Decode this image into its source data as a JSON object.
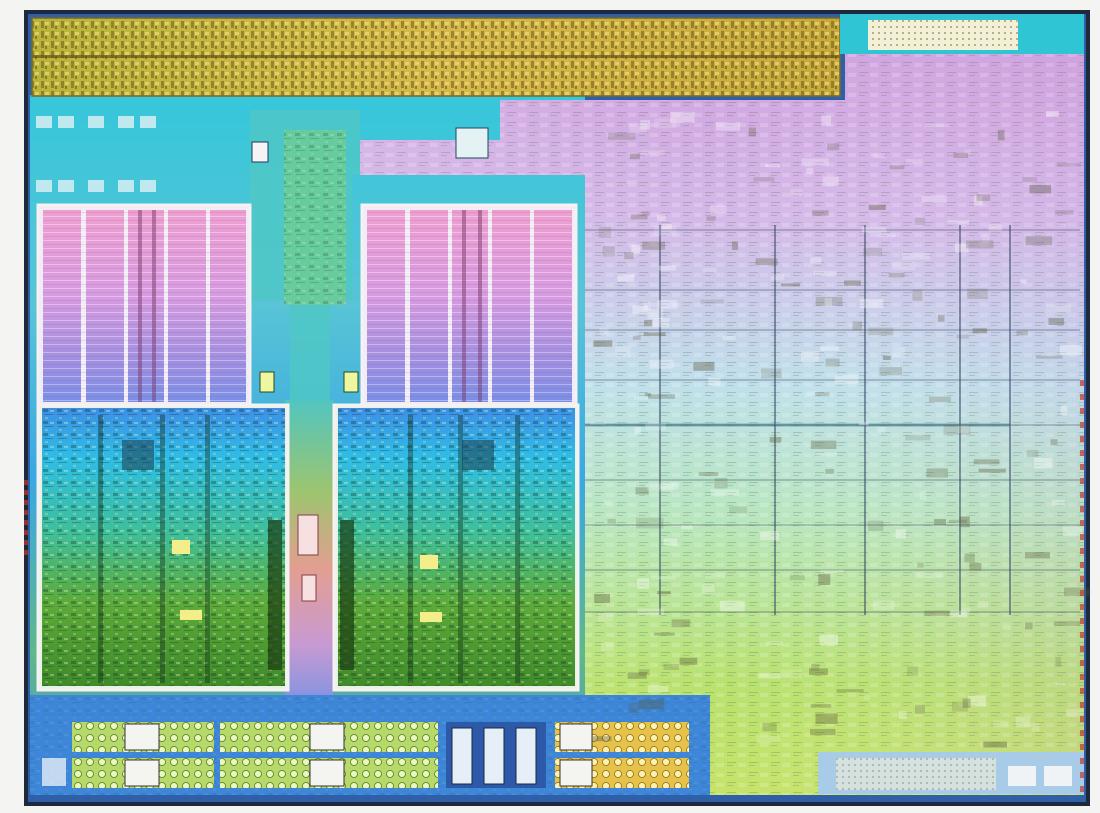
{
  "image": {
    "subject": "processor-die-photograph",
    "background_color": "#f4f4f2",
    "die_border_color": "#1e2a3c"
  },
  "palette": {
    "io_strip_yellow": "#c9b93a",
    "cache_pink": "#e8a6d6",
    "cache_violet": "#a88fd8",
    "logic_blue": "#2ea7e0",
    "logic_green": "#7bbf3a",
    "cyan": "#3cc9d8",
    "gpu_lavender": "#d9b4e8",
    "gpu_mint": "#b8e6c8",
    "gpu_lime": "#b4e07a",
    "spine_salmon": "#e6a08f"
  }
}
